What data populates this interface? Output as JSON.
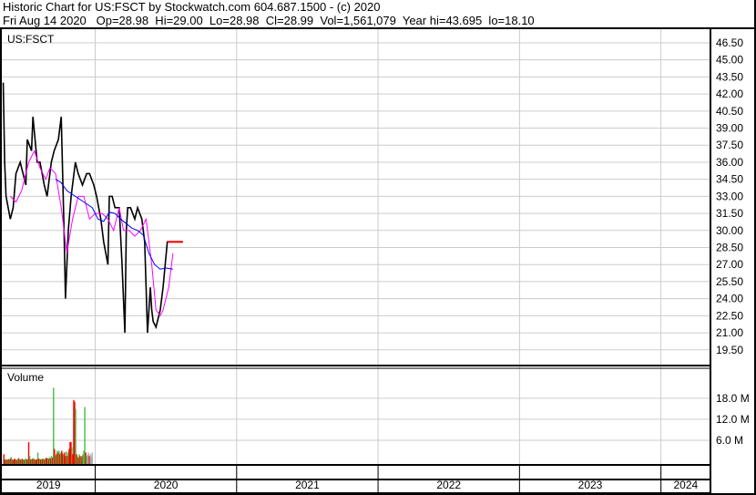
{
  "header": {
    "title": "Historic Chart for US:FSCT by Stockwatch.com 604.687.1500 - (c) 2020",
    "quote": "Fri Aug 14 2020   Op=28.98  Hi=29.00  Lo=28.98  Cl=28.99  Vol=1,561,079  Year hi=43.695  lo=18.10"
  },
  "chart_data": {
    "type": "line",
    "symbol": "US:FSCT",
    "price_axis": {
      "ticks": [
        "46.50",
        "45.00",
        "43.50",
        "42.00",
        "40.50",
        "39.00",
        "37.50",
        "36.00",
        "34.50",
        "33.00",
        "31.50",
        "30.00",
        "28.50",
        "27.00",
        "25.50",
        "24.00",
        "22.50",
        "21.00",
        "19.50"
      ],
      "ylim": [
        18.2,
        47.7
      ]
    },
    "volume_axis": {
      "label": "Volume",
      "ticks": [
        "18.0 M",
        "12.0 M",
        "6.0 M"
      ],
      "tick_values": [
        18,
        12,
        6
      ],
      "ylim": [
        0,
        25
      ]
    },
    "x_axis": {
      "years": [
        "2019",
        "2020",
        "2021",
        "2022",
        "2023",
        "2024"
      ],
      "xlim": [
        2019.34,
        2024.35
      ]
    },
    "colors": {
      "price": "#000000",
      "ma_short": "#ff00ff",
      "ma_long": "#0000ff",
      "vol_up": "#44bb44",
      "vol_down": "#ff0000",
      "vol_flat": "#aaaaaa"
    },
    "price": {
      "t": [
        2019.35,
        2019.36,
        2019.37,
        2019.4,
        2019.42,
        2019.44,
        2019.47,
        2019.51,
        2019.52,
        2019.55,
        2019.56,
        2019.59,
        2019.61,
        2019.64,
        2019.66,
        2019.69,
        2019.71,
        2019.74,
        2019.76,
        2019.78,
        2019.79,
        2019.81,
        2019.83,
        2019.86,
        2019.88,
        2019.91,
        2019.94,
        2019.96,
        2019.99,
        2020.01,
        2020.04,
        2020.06,
        2020.09,
        2020.1,
        2020.12,
        2020.14,
        2020.17,
        2020.19,
        2020.21,
        2020.22,
        2020.23,
        2020.25,
        2020.28,
        2020.3,
        2020.33,
        2020.35,
        2020.37,
        2020.39,
        2020.4,
        2020.41,
        2020.43,
        2020.46,
        2020.48,
        2020.51,
        2020.54,
        2020.56,
        2020.62
      ],
      "close": [
        43.0,
        36,
        33,
        31,
        32,
        35,
        36,
        34,
        38,
        37,
        40,
        36,
        36,
        34,
        33,
        36,
        37,
        38,
        40,
        30,
        24,
        30,
        33,
        36,
        35,
        34,
        35,
        35,
        34,
        33,
        31,
        29,
        27,
        33,
        33,
        32,
        32,
        27,
        21,
        30,
        32,
        32,
        31,
        32,
        31,
        29,
        21,
        25,
        23,
        22,
        21.5,
        23,
        25,
        29,
        29,
        29,
        28.99
      ]
    },
    "ma_short": {
      "t": [
        2019.4,
        2019.44,
        2019.48,
        2019.53,
        2019.57,
        2019.61,
        2019.65,
        2019.68,
        2019.72,
        2019.76,
        2019.8,
        2019.84,
        2019.88,
        2019.92,
        2019.96,
        2020.0,
        2020.05,
        2020.09,
        2020.13,
        2020.17,
        2020.2,
        2020.24,
        2020.28,
        2020.32,
        2020.36,
        2020.4,
        2020.43,
        2020.46,
        2020.48,
        2020.52,
        2020.55
      ],
      "values": [
        33,
        32.5,
        33.5,
        36,
        37,
        35.5,
        34.5,
        35.5,
        35,
        32,
        28,
        31,
        33,
        33,
        31,
        31.5,
        31.5,
        31,
        30,
        32,
        30,
        30,
        29.5,
        30,
        31,
        27,
        23,
        22.5,
        23,
        25,
        28
      ]
    },
    "ma_long": {
      "t": [
        2019.72,
        2019.76,
        2019.8,
        2019.86,
        2019.92,
        2019.98,
        2020.02,
        2020.06,
        2020.1,
        2020.14,
        2020.18,
        2020.22,
        2020.26,
        2020.3,
        2020.34,
        2020.38,
        2020.42,
        2020.46,
        2020.5,
        2020.55
      ],
      "values": [
        34.5,
        34.2,
        33.5,
        33,
        32.5,
        32,
        31,
        30.8,
        31.6,
        31.5,
        31,
        30.6,
        30.2,
        30,
        29.6,
        28,
        27,
        26.6,
        26.7,
        26.6
      ]
    },
    "volume": {
      "t_start": 2019.35,
      "t_step": 0.0065,
      "values": [
        2,
        0.5,
        0.6,
        0.4,
        0.5,
        0.6,
        0.5,
        0.8,
        1.2,
        0.5,
        0.4,
        0.6,
        0.7,
        0.5,
        0.4,
        0.5,
        0.9,
        0.6,
        0.5,
        0.6,
        0.7,
        0.5,
        0.4,
        0.6,
        0.8,
        0.5,
        0.6,
        5.5,
        1.5,
        0.6,
        0.5,
        0.7,
        0.9,
        0.6,
        0.5,
        0.4,
        0.6,
        2.5,
        0.8,
        0.6,
        0.5,
        0.7,
        0.6,
        0.8,
        0.5,
        0.6,
        1,
        0.8,
        0.9,
        0.7,
        1.2,
        0.8,
        1.5,
        1,
        21,
        3.5,
        1.5,
        2,
        3,
        2.5,
        3,
        2,
        2.5,
        3,
        2.2,
        1.8,
        2.5,
        1.5,
        2.8,
        1.5,
        2.5,
        3.5,
        5.5,
        5.5,
        4,
        2,
        17.5,
        17,
        15,
        2,
        1.5,
        1,
        2,
        1.5,
        1,
        1.5,
        2,
        3,
        15.5,
        2.5,
        1.5,
        1.8,
        2.5,
        1.5,
        2,
        1.2,
        2.5
      ],
      "colors": [
        "d",
        "d",
        "u",
        "d",
        "u",
        "d",
        "u",
        "d",
        "u",
        "d",
        "u",
        "d",
        "d",
        "u",
        "d",
        "u",
        "d",
        "u",
        "d",
        "u",
        "d",
        "u",
        "d",
        "u",
        "u",
        "d",
        "u",
        "d",
        "u",
        "d",
        "u",
        "d",
        "u",
        "d",
        "u",
        "d",
        "d",
        "u",
        "d",
        "u",
        "d",
        "u",
        "d",
        "u",
        "d",
        "u",
        "d",
        "d",
        "u",
        "d",
        "u",
        "d",
        "u",
        "d",
        "u",
        "d",
        "u",
        "d",
        "u",
        "d",
        "u",
        "d",
        "u",
        "d",
        "d",
        "u",
        "d",
        "d",
        "u",
        "d",
        "u",
        "d",
        "d",
        "d",
        "u",
        "d",
        "d",
        "d",
        "u",
        "d",
        "u",
        "d",
        "u",
        "d",
        "u",
        "d",
        "u",
        "u",
        "u",
        "d",
        "u",
        "f",
        "f",
        "d",
        "f",
        "f",
        "f"
      ]
    }
  }
}
